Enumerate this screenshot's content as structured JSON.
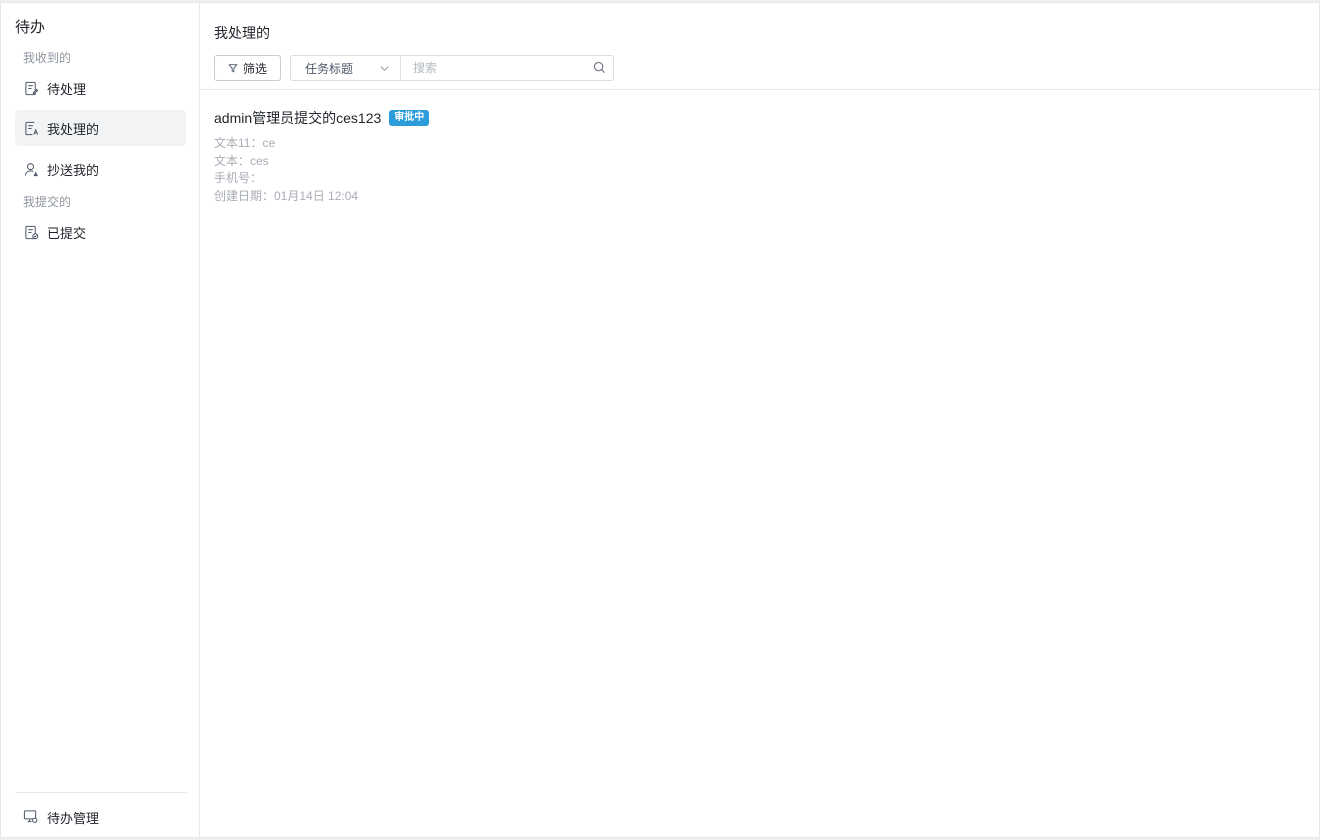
{
  "sidebar": {
    "title": "待办",
    "groups": [
      {
        "label": "我收到的"
      },
      {
        "label": "我提交的"
      }
    ],
    "items": [
      {
        "label": "待处理",
        "icon": "pending-doc-icon"
      },
      {
        "label": "我处理的",
        "icon": "handled-doc-icon"
      },
      {
        "label": "抄送我的",
        "icon": "cc-user-icon"
      },
      {
        "label": "已提交",
        "icon": "submitted-doc-icon"
      }
    ],
    "footer": {
      "label": "待办管理",
      "icon": "manage-monitor-icon"
    }
  },
  "main": {
    "title": "我处理的",
    "filter_button": "筛选",
    "select": {
      "value": "任务标题"
    },
    "search": {
      "placeholder": "搜索",
      "value": ""
    },
    "tasks": [
      {
        "title": "admin管理员提交的ces123",
        "status": "审批中",
        "fields": [
          "文本11：ce",
          "文本：ces",
          "手机号：",
          "创建日期：01月14日 12:04"
        ]
      }
    ]
  },
  "colors": {
    "accent": "#2d9cdb",
    "active_bg": "#f2f3f5",
    "muted_text": "#a8adb5"
  }
}
